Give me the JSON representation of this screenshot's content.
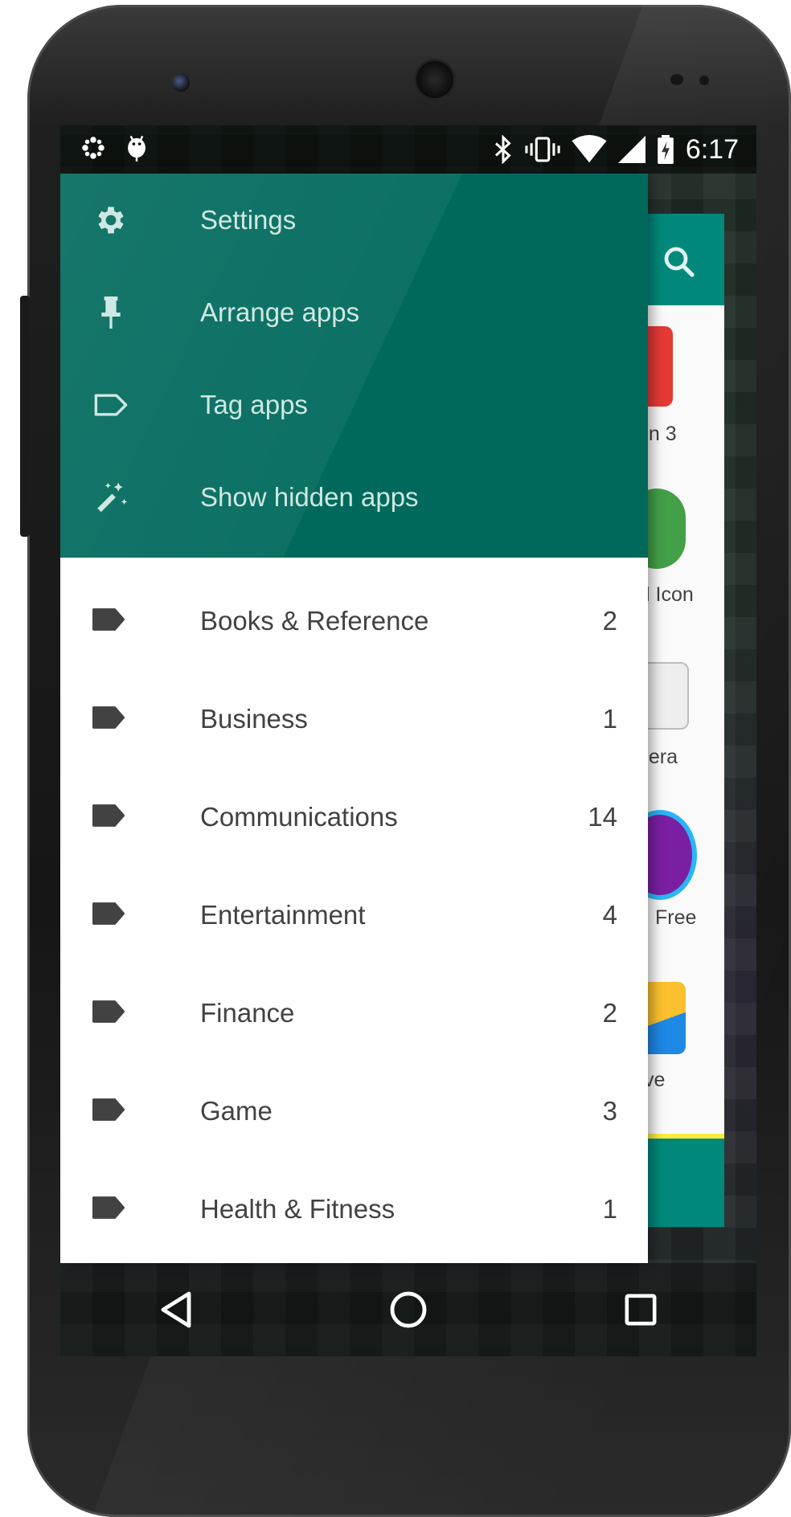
{
  "status_bar": {
    "time": "6:17",
    "icons": [
      "pinwheel-icon",
      "android-debug-icon",
      "bluetooth-icon",
      "vibrate-icon",
      "wifi-icon",
      "cell-signal-icon",
      "battery-charging-icon"
    ]
  },
  "drawer": {
    "menu": [
      {
        "label": "Settings",
        "icon": "gear-icon"
      },
      {
        "label": "Arrange apps",
        "icon": "pin-icon"
      },
      {
        "label": "Tag apps",
        "icon": "tag-outline-icon"
      },
      {
        "label": "Show hidden apps",
        "icon": "magic-wand-icon"
      }
    ],
    "tags": [
      {
        "label": "Books & Reference",
        "count": "2"
      },
      {
        "label": "Business",
        "count": "1"
      },
      {
        "label": "Communications",
        "count": "14"
      },
      {
        "label": "Entertainment",
        "count": "4"
      },
      {
        "label": "Finance",
        "count": "2"
      },
      {
        "label": "Game",
        "count": "3"
      },
      {
        "label": "Health & Fitness",
        "count": "1"
      }
    ]
  },
  "background_app": {
    "partial_labels": [
      "on 3",
      "l Icon",
      "nera",
      "Free",
      "ve"
    ]
  },
  "colors": {
    "drawer_header": "#00695c",
    "accent": "#00897b",
    "tag_icon": "#424242"
  },
  "nav_bar": [
    "back-icon",
    "home-icon",
    "recents-icon"
  ]
}
